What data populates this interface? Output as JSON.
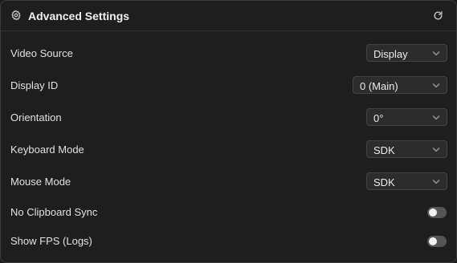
{
  "header": {
    "title": "Advanced Settings"
  },
  "settings": [
    {
      "label": "Video Source",
      "value": "Display"
    },
    {
      "label": "Display ID",
      "value": "0 (Main)"
    },
    {
      "label": "Orientation",
      "value": "0°"
    },
    {
      "label": "Keyboard Mode",
      "value": "SDK"
    },
    {
      "label": "Mouse Mode",
      "value": "SDK"
    }
  ],
  "toggles": [
    {
      "label": "No Clipboard Sync",
      "on": false
    },
    {
      "label": "Show FPS (Logs)",
      "on": false
    }
  ],
  "colors": {
    "background": "#1e1e1e",
    "toggle_off": "#555555",
    "select_bg": "#2c2c2c"
  },
  "icons": {
    "header_left": "gear-icon",
    "header_right": "refresh-icon",
    "select": "chevron-down-icon"
  }
}
